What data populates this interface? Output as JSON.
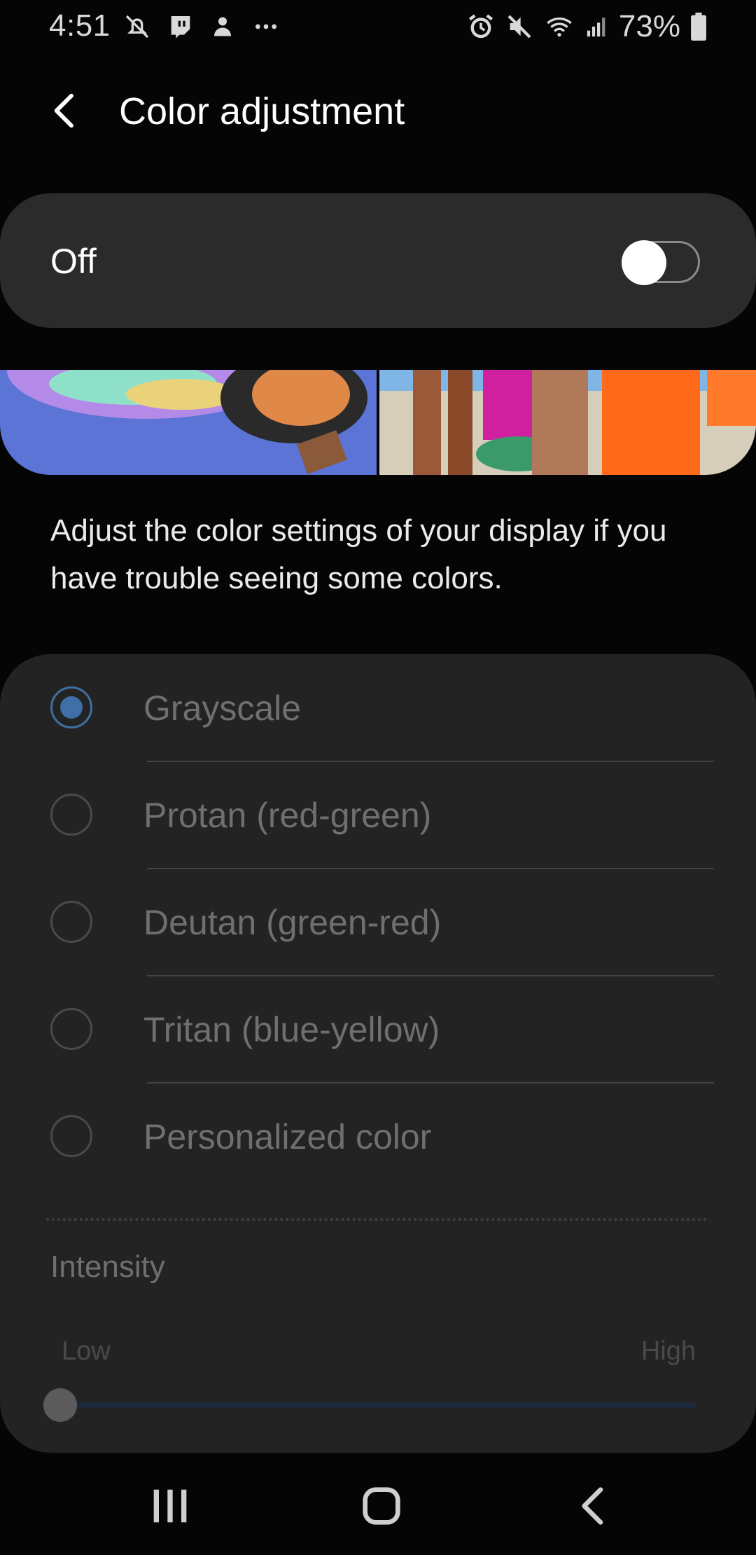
{
  "status_bar": {
    "time": "4:51",
    "battery_percent": "73%",
    "left_icons": [
      "notifications-off-icon",
      "twitch-icon",
      "app-icon",
      "more-dots-icon"
    ],
    "right_icons": [
      "alarm-icon",
      "mute-icon",
      "wifi-icon",
      "signal-icon",
      "battery-icon"
    ]
  },
  "app_bar": {
    "title": "Color adjustment"
  },
  "master_toggle": {
    "label": "Off",
    "state": false
  },
  "description": "Adjust the color settings of your display if you have trouble seeing some colors.",
  "options": [
    {
      "label": "Grayscale",
      "selected": true
    },
    {
      "label": "Protan (red-green)",
      "selected": false
    },
    {
      "label": "Deutan (green-red)",
      "selected": false
    },
    {
      "label": "Tritan (blue-yellow)",
      "selected": false
    },
    {
      "label": "Personalized color",
      "selected": false
    }
  ],
  "intensity": {
    "title": "Intensity",
    "low_label": "Low",
    "high_label": "High",
    "value": 0
  },
  "colors": {
    "background": "#050505",
    "card": "#2b2b2b",
    "options_card": "#232323",
    "accent": "#3f6fa6"
  },
  "nav_bar": [
    "recents-icon",
    "home-icon",
    "back-icon"
  ]
}
